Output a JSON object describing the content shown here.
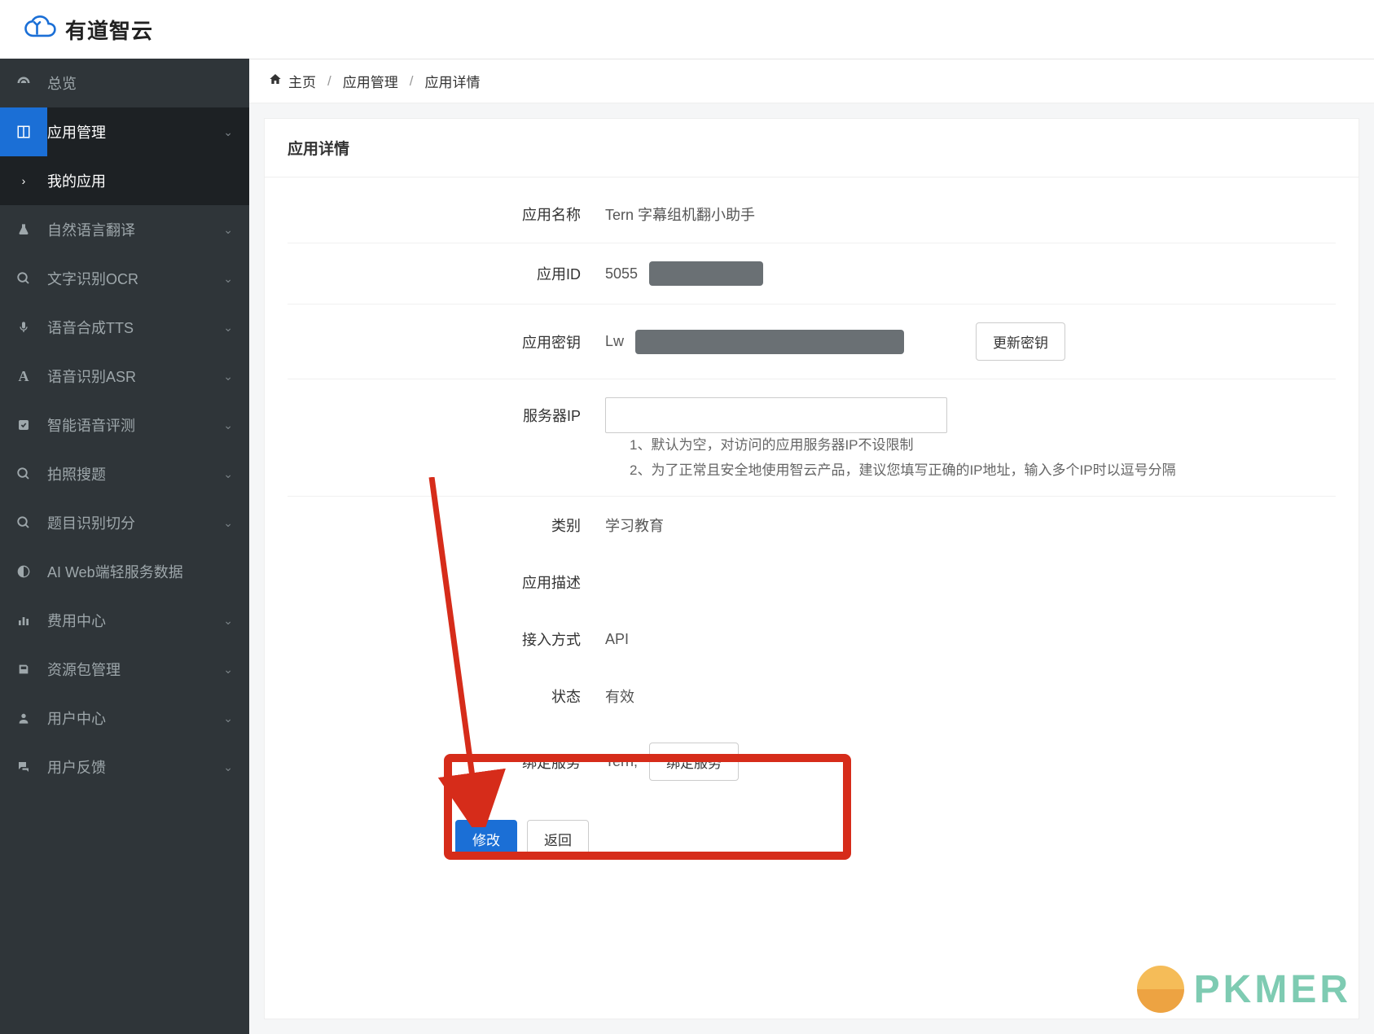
{
  "brand": {
    "name": "有道智云"
  },
  "breadcrumb": {
    "home": "主页",
    "l1": "应用管理",
    "l2": "应用详情"
  },
  "sidebar": {
    "items": [
      {
        "label": "总览"
      },
      {
        "label": "应用管理"
      },
      {
        "label": "我的应用"
      },
      {
        "label": "自然语言翻译"
      },
      {
        "label": "文字识别OCR"
      },
      {
        "label": "语音合成TTS"
      },
      {
        "label": "语音识别ASR"
      },
      {
        "label": "智能语音评测"
      },
      {
        "label": "拍照搜题"
      },
      {
        "label": "题目识别切分"
      },
      {
        "label": "AI Web端轻服务数据"
      },
      {
        "label": "费用中心"
      },
      {
        "label": "资源包管理"
      },
      {
        "label": "用户中心"
      },
      {
        "label": "用户反馈"
      }
    ]
  },
  "panel": {
    "title": "应用详情",
    "fields": {
      "app_name_label": "应用名称",
      "app_name_value": "Tern 字幕组机翻小助手",
      "app_id_label": "应用ID",
      "app_id_prefix": "5055",
      "app_secret_label": "应用密钥",
      "app_secret_prefix": "Lw",
      "refresh_secret_btn": "更新密钥",
      "server_ip_label": "服务器IP",
      "server_ip_hint1": "1、默认为空，对访问的应用服务器IP不设限制",
      "server_ip_hint2": "2、为了正常且安全地使用智云产品，建议您填写正确的IP地址，输入多个IP时以逗号分隔",
      "category_label": "类别",
      "category_value": "学习教育",
      "desc_label": "应用描述",
      "desc_value": "",
      "access_label": "接入方式",
      "access_value": "API",
      "status_label": "状态",
      "status_value": "有效",
      "bind_label": "绑定服务",
      "bind_value": "Tern;",
      "bind_btn": "绑定服务"
    },
    "actions": {
      "modify": "修改",
      "back": "返回"
    }
  },
  "watermark": {
    "text": "PKMER"
  }
}
